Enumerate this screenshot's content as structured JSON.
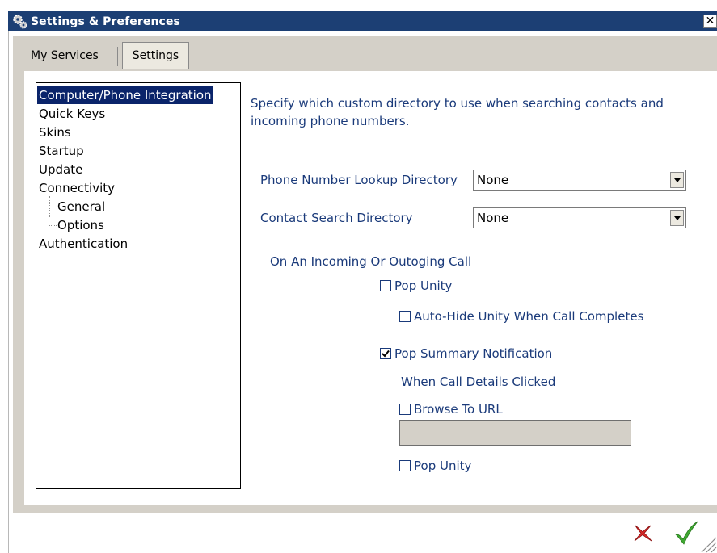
{
  "window": {
    "title": "Settings & Preferences",
    "close_symbol": "✕"
  },
  "tabs": [
    {
      "label": "My Services",
      "active": false
    },
    {
      "label": "Settings",
      "active": true
    }
  ],
  "tree": {
    "items": [
      {
        "label": "Computer/Phone Integration",
        "selected": true
      },
      {
        "label": "Quick Keys"
      },
      {
        "label": "Skins"
      },
      {
        "label": "Startup"
      },
      {
        "label": "Update"
      },
      {
        "label": "Connectivity"
      },
      {
        "label": "Authentication"
      }
    ],
    "connectivity_children": [
      {
        "label": "General"
      },
      {
        "label": "Options"
      }
    ]
  },
  "panel": {
    "description": "Specify which custom directory to use when searching contacts and incoming phone numbers.",
    "phone_lookup": {
      "label": "Phone Number Lookup Directory",
      "value": "None"
    },
    "contact_search": {
      "label": "Contact Search Directory",
      "value": "None"
    },
    "call_section_label": "On An Incoming Or Outoging Call",
    "pop_unity": {
      "label": "Pop Unity",
      "checked": false
    },
    "auto_hide": {
      "label": "Auto-Hide Unity When Call Completes",
      "checked": false
    },
    "pop_summary": {
      "label": "Pop Summary Notification",
      "checked": true
    },
    "call_details_label": "When Call Details Clicked",
    "browse_url": {
      "label": "Browse To URL",
      "checked": false,
      "value": ""
    },
    "pop_unity_2": {
      "label": "Pop Unity",
      "checked": false
    }
  },
  "footer": {
    "cancel_icon": "red-x-icon",
    "ok_icon": "green-check-icon"
  },
  "colors": {
    "titlebar": "#1c3f74",
    "selection": "#0a246a",
    "label_blue": "#1a3a7a",
    "panel_grey": "#d4d0c8"
  }
}
